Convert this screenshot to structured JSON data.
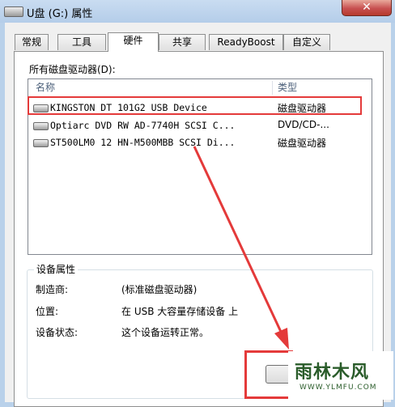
{
  "window": {
    "title": "U盘 (G:) 属性",
    "close_symbol": "✕"
  },
  "tabs": [
    {
      "label": "常规",
      "active": false
    },
    {
      "label": "工具",
      "active": false
    },
    {
      "label": "硬件",
      "active": true
    },
    {
      "label": "共享",
      "active": false
    },
    {
      "label": "ReadyBoost",
      "active": false
    },
    {
      "label": "自定义",
      "active": false
    }
  ],
  "hardware": {
    "drives_label": "所有磁盘驱动器(D):",
    "columns": {
      "name": "名称",
      "type": "类型"
    },
    "drives": [
      {
        "name": "KINGSTON DT 101G2 USB Device",
        "type": "磁盘驱动器",
        "icon": "usb-drive-icon",
        "highlighted": true
      },
      {
        "name": "Optiarc DVD RW AD-7740H SCSI C...",
        "type": "DVD/CD-...",
        "icon": "dvd-drive-icon",
        "highlighted": false
      },
      {
        "name": "ST500LM0 12 HN-M500MBB SCSI Di...",
        "type": "磁盘驱动器",
        "icon": "hard-drive-icon",
        "highlighted": false
      }
    ]
  },
  "device_properties": {
    "group_title": "设备属性",
    "manufacturer_label": "制造商:",
    "manufacturer_value": "(标准磁盘驱动器)",
    "location_label": "位置:",
    "location_value": "在 USB 大容量存储设备 上",
    "status_label": "设备状态:",
    "status_value": "这个设备运转正常。"
  },
  "annotation": {
    "highlight_color": "#e43a3a"
  },
  "watermark": {
    "main": "雨林木风",
    "sub": "WWW.YLMFU.COM"
  }
}
